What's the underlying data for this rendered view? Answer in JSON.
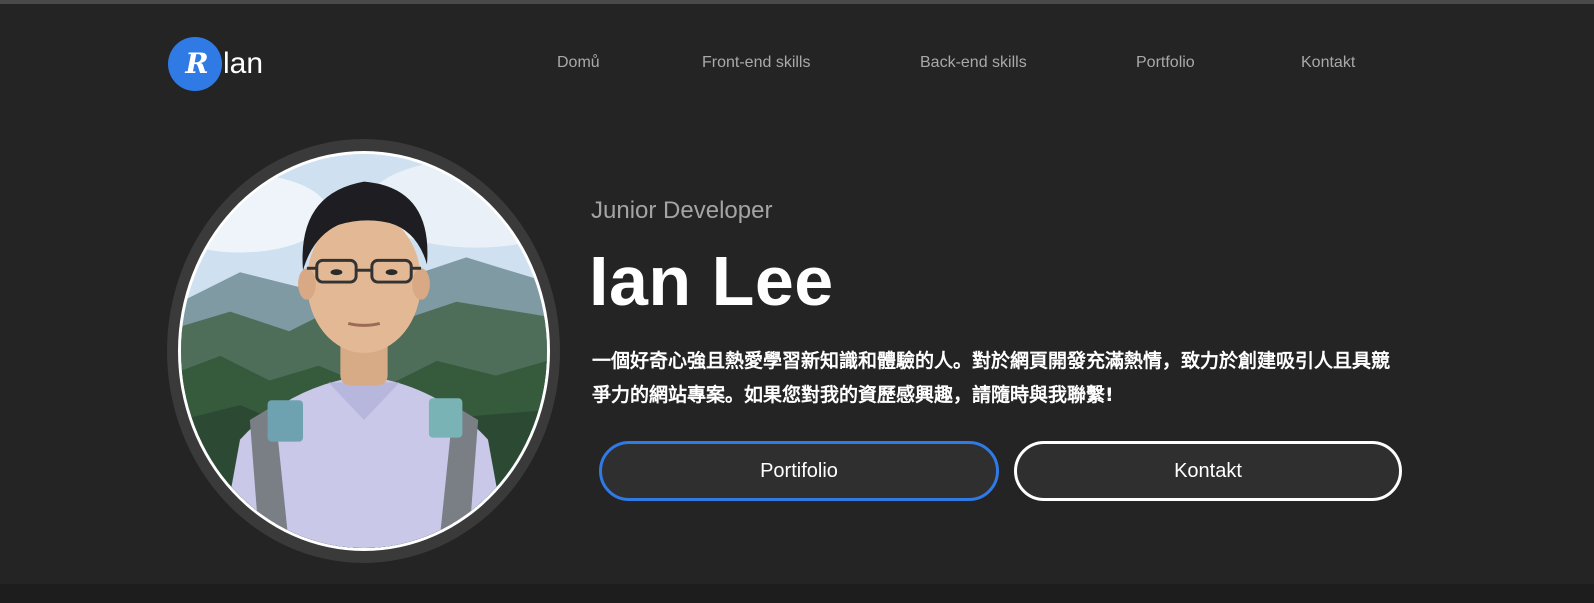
{
  "nav": {
    "brand_logo_letter": "R",
    "brand_name": "lan",
    "links": [
      "Domů",
      "Front-end skills",
      "Back-end skills",
      "Portfolio",
      "Kontakt"
    ]
  },
  "hero": {
    "subtitle": "Junior Developer",
    "name": "Ian Lee",
    "bio": "一個好奇心強且熱愛學習新知識和體驗的人。對於網頁開發充滿熱情，致力於創建吸引人且具競爭力的網站專案。如果您對我的資歷感興趣，請隨時與我聯繫!",
    "buttons": {
      "portfolio": "Portifolio",
      "kontakt": "Kontakt"
    }
  },
  "colors": {
    "background": "#242424",
    "accent": "#2f7ae5",
    "nav_text": "#a9a9a9",
    "button_fill": "#2f2f30"
  }
}
